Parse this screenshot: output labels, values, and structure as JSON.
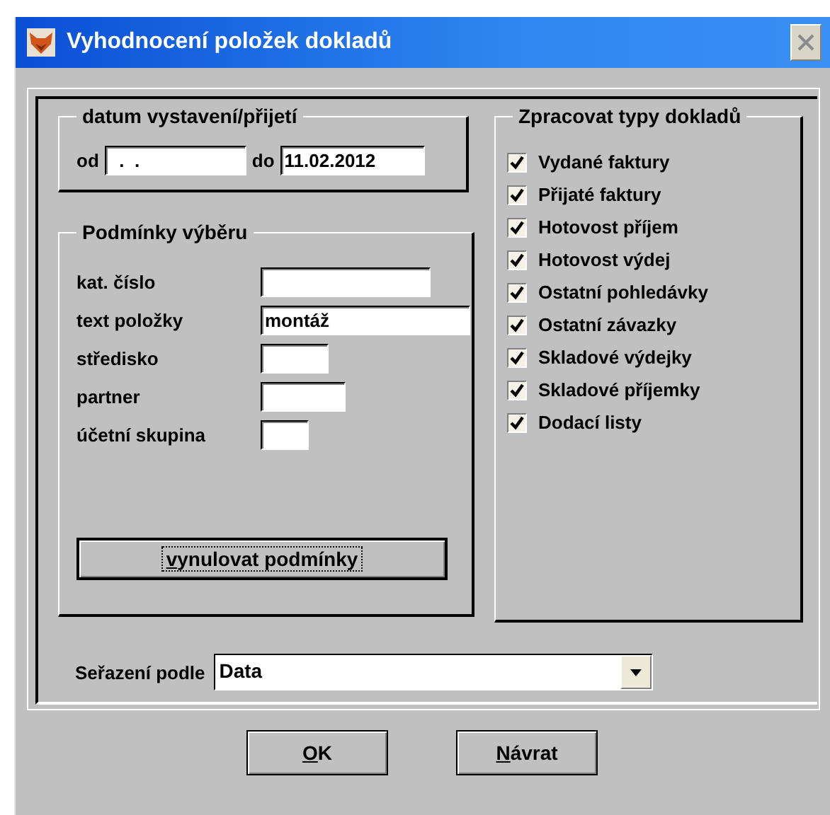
{
  "window": {
    "title": "Vyhodnocení položek dokladů"
  },
  "date_group": {
    "title": "datum vystavení/přijetí",
    "from_label": "od",
    "from_value": "  .  .",
    "to_label": "do",
    "to_value": "11.02.2012"
  },
  "conditions": {
    "title": "Podmínky výběru",
    "fields": [
      {
        "label": "kat. číslo"
      },
      {
        "label": "text položky",
        "value": "montáž"
      },
      {
        "label": "středisko"
      },
      {
        "label": "partner"
      },
      {
        "label": "účetní skupina"
      }
    ],
    "reset_button": {
      "label": "vynulovat podmínky",
      "underline_first": true,
      "focused": true
    }
  },
  "doc_types": {
    "title": "Zpracovat typy dokladů",
    "items": [
      {
        "label": "Vydané faktury",
        "checked": true
      },
      {
        "label": "Přijaté faktury",
        "checked": true
      },
      {
        "label": "Hotovost příjem",
        "checked": true
      },
      {
        "label": "Hotovost výdej",
        "checked": true
      },
      {
        "label": "Ostatní pohledávky",
        "checked": true
      },
      {
        "label": "Ostatní závazky",
        "checked": true
      },
      {
        "label": "Skladové výdejky",
        "checked": true
      },
      {
        "label": "Skladové příjemky",
        "checked": true
      },
      {
        "label": "Dodací listy",
        "checked": true
      }
    ]
  },
  "sort": {
    "label": "Seřazení podle",
    "value": "Data"
  },
  "buttons": [
    {
      "label": "OK",
      "underline_first": true
    },
    {
      "label": "Návrat",
      "underline_first": true
    }
  ]
}
